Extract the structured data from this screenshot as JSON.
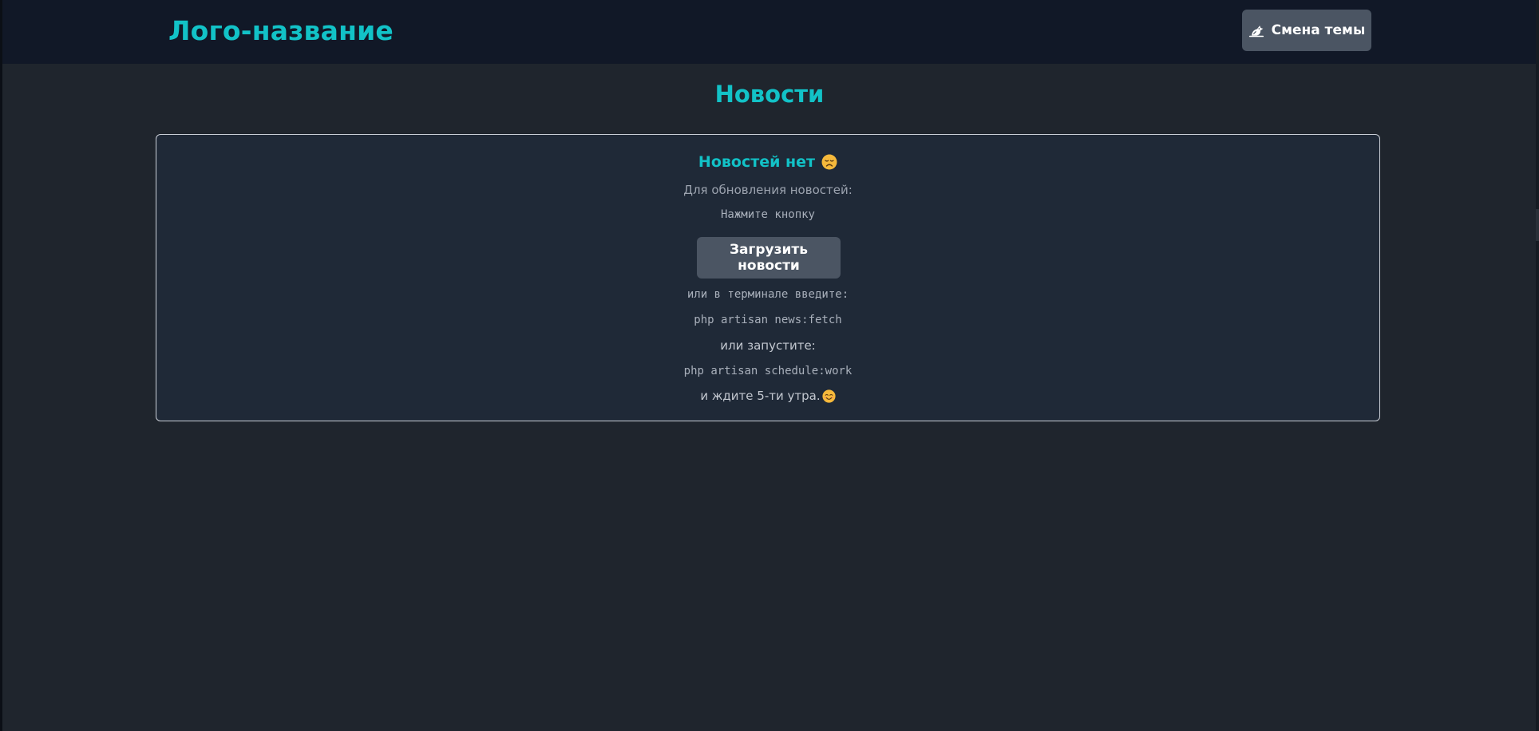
{
  "header": {
    "logo_text": "Лого-название",
    "theme_button_label": "Смена темы",
    "theme_button_icon": "theme-icon"
  },
  "main": {
    "page_title": "Новости"
  },
  "news_card": {
    "empty_title": "Новостей нет",
    "empty_title_emoji": "sad-face-emoji",
    "update_hint": "Для обновления новостей:",
    "press_button_hint": "Нажмите кнопку",
    "load_button_label": "Загрузить новости",
    "terminal_hint": "или в терминале введите:",
    "command_fetch": "php artisan news:fetch",
    "or_run_hint": "или запустите:",
    "command_schedule": "php artisan schedule:work",
    "wait_hint": "и ждите 5-ти утра.",
    "wait_hint_emoji": "smiling-face-emoji"
  },
  "colors": {
    "accent": "#12c2c7",
    "header_bg": "#111827",
    "page_bg": "#1f252d",
    "card_bg": "#1f2937",
    "button_bg": "#4b5563",
    "muted_text": "#9ca3af"
  }
}
